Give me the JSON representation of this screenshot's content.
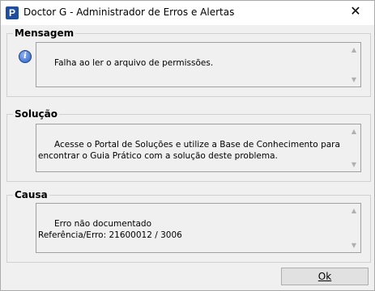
{
  "window": {
    "title": "Doctor G - Administrador de Erros e Alertas",
    "app_icon_letter": "P",
    "close_glyph": "✕"
  },
  "mensagem": {
    "label": "Mensagem",
    "text": "Falha ao ler o arquivo de permissões.",
    "icon": "info-icon"
  },
  "solucao": {
    "label": "Solução",
    "text": "Acesse o Portal de Soluções e utilize a Base de Conhecimento para encontrar o Guia Prático com a solução deste problema."
  },
  "causa": {
    "label": "Causa",
    "text": "Erro não documentado\nReferência/Erro: 21600012 / 3006"
  },
  "buttons": {
    "ok_label": "Ok"
  },
  "scroll": {
    "up_glyph": "▲",
    "down_glyph": "▼"
  }
}
